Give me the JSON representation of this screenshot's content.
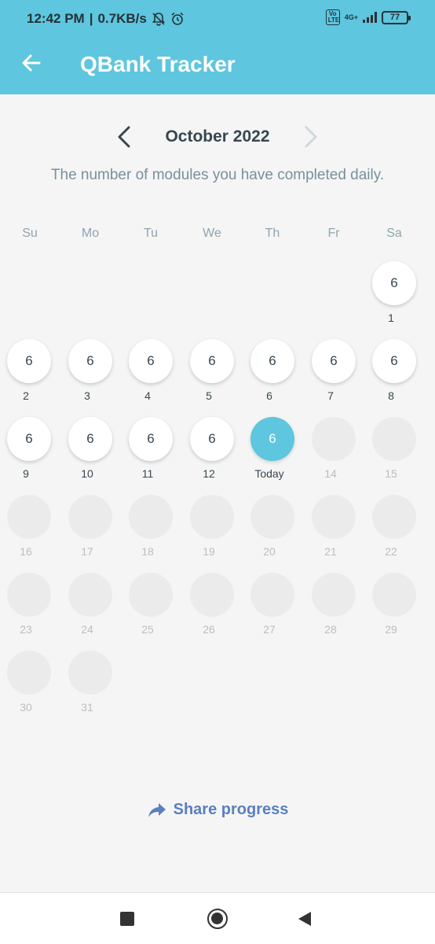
{
  "status_bar": {
    "time": "12:42 PM",
    "separator": "|",
    "speed": "0.7KB/s",
    "volte": "Vo LTE",
    "network": "4G+",
    "battery": "77"
  },
  "app_bar": {
    "title": "QBank Tracker"
  },
  "calendar": {
    "month": "October 2022",
    "subtitle": "The number of modules you have completed daily.",
    "weekdays": [
      "Su",
      "Mo",
      "Tu",
      "We",
      "Th",
      "Fr",
      "Sa"
    ],
    "first_weekday_index": 6,
    "today_label": "Today",
    "days": [
      {
        "day": "1",
        "count": "6",
        "state": "done"
      },
      {
        "day": "2",
        "count": "6",
        "state": "done"
      },
      {
        "day": "3",
        "count": "6",
        "state": "done"
      },
      {
        "day": "4",
        "count": "6",
        "state": "done"
      },
      {
        "day": "5",
        "count": "6",
        "state": "done"
      },
      {
        "day": "6",
        "count": "6",
        "state": "done"
      },
      {
        "day": "7",
        "count": "6",
        "state": "done"
      },
      {
        "day": "8",
        "count": "6",
        "state": "done"
      },
      {
        "day": "9",
        "count": "6",
        "state": "done"
      },
      {
        "day": "10",
        "count": "6",
        "state": "done"
      },
      {
        "day": "11",
        "count": "6",
        "state": "done"
      },
      {
        "day": "12",
        "count": "6",
        "state": "done"
      },
      {
        "day": "13",
        "count": "6",
        "state": "today"
      },
      {
        "day": "14",
        "count": "",
        "state": "future"
      },
      {
        "day": "15",
        "count": "",
        "state": "future"
      },
      {
        "day": "16",
        "count": "",
        "state": "future"
      },
      {
        "day": "17",
        "count": "",
        "state": "future"
      },
      {
        "day": "18",
        "count": "",
        "state": "future"
      },
      {
        "day": "19",
        "count": "",
        "state": "future"
      },
      {
        "day": "20",
        "count": "",
        "state": "future"
      },
      {
        "day": "21",
        "count": "",
        "state": "future"
      },
      {
        "day": "22",
        "count": "",
        "state": "future"
      },
      {
        "day": "23",
        "count": "",
        "state": "future"
      },
      {
        "day": "24",
        "count": "",
        "state": "future"
      },
      {
        "day": "25",
        "count": "",
        "state": "future"
      },
      {
        "day": "26",
        "count": "",
        "state": "future"
      },
      {
        "day": "27",
        "count": "",
        "state": "future"
      },
      {
        "day": "28",
        "count": "",
        "state": "future"
      },
      {
        "day": "29",
        "count": "",
        "state": "future"
      },
      {
        "day": "30",
        "count": "",
        "state": "future"
      },
      {
        "day": "31",
        "count": "",
        "state": "future"
      }
    ]
  },
  "share": {
    "label": "Share progress",
    "icon": "share-arrow-icon",
    "color": "#5a7fc0"
  },
  "colors": {
    "accent": "#5ec6de",
    "background": "#f5f5f5"
  },
  "nav_bar": {
    "icons": [
      "recents-square-icon",
      "home-circle-icon",
      "back-triangle-icon"
    ]
  }
}
